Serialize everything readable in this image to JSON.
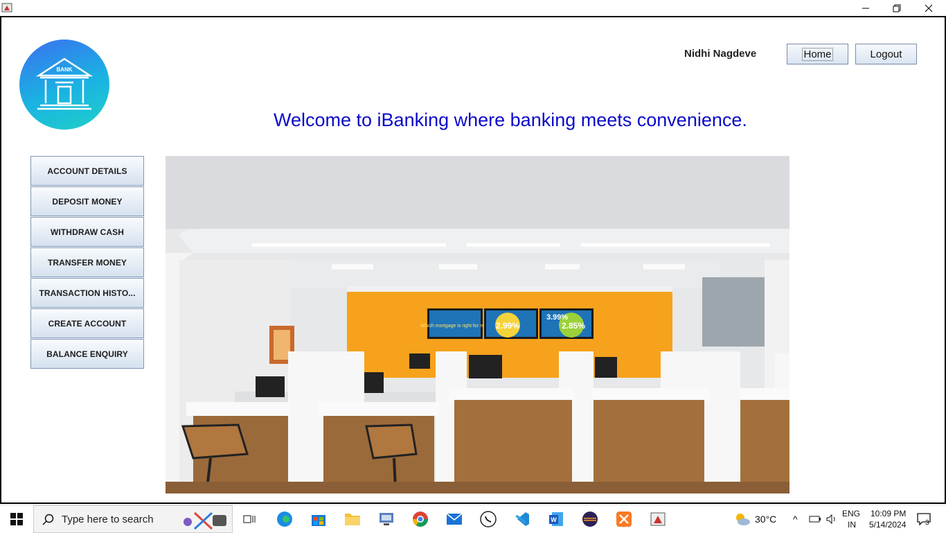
{
  "window": {
    "minimize": "—",
    "restore": "❐",
    "close": "✕"
  },
  "header": {
    "username": "Nidhi Nagdeve",
    "home_label": "Home",
    "logout_label": "Logout",
    "welcome": "Welcome to iBanking where banking meets convenience.",
    "logo_text": "BANK"
  },
  "menu": {
    "items": [
      {
        "label": "ACCOUNT DETAILS"
      },
      {
        "label": "DEPOSIT MONEY"
      },
      {
        "label": "WITHDRAW CASH"
      },
      {
        "label": "TRANSFER MONEY"
      },
      {
        "label": "TRANSACTION HISTO..."
      },
      {
        "label": "CREATE ACCOUNT"
      },
      {
        "label": "BALANCE ENQUIRY"
      }
    ]
  },
  "photo": {
    "screen1": "Which mortgage is right for me?",
    "screen2": "2.99%",
    "screen3": "3.99%",
    "screen4": "2.85%"
  },
  "taskbar": {
    "search_placeholder": "Type here to search",
    "weather": "30°C",
    "lang1": "ENG",
    "lang2": "IN",
    "time": "10:09 PM",
    "date": "5/14/2024",
    "notifications": "3"
  },
  "colors": {
    "welcome": "#0b0bc8",
    "accent_wall": "#f7a21c"
  }
}
